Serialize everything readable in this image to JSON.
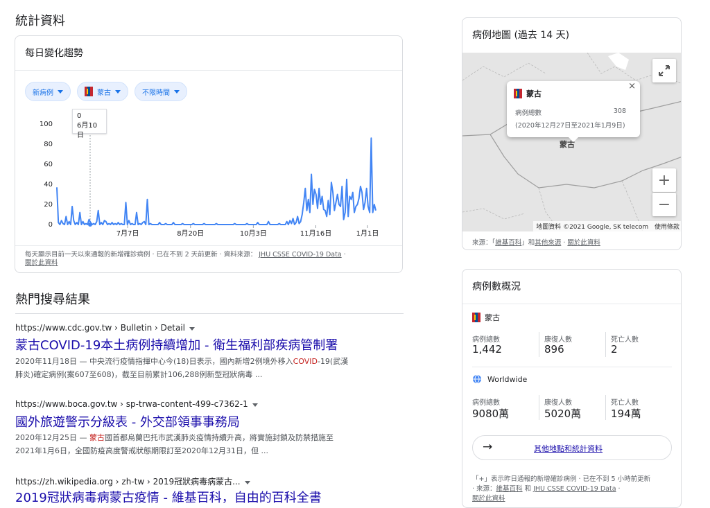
{
  "stats_heading": "統計資料",
  "trend_card": {
    "title": "每日變化趨勢",
    "chip_metric": "新病例",
    "chip_region": "蒙古",
    "chip_time": "不限時間",
    "tooltip_value": "0",
    "tooltip_date": "6月10日",
    "footer_text": "每天顯示目前一天以來通報的新增確診病例 · 已在不到 2 天前更新 · 資料來源：",
    "footer_source": "JHU CSSE COVID-19 Data",
    "footer_about": "關於此資料"
  },
  "chart_data": {
    "type": "line",
    "title": "",
    "xlabel": "",
    "ylabel": "",
    "ylim": [
      0,
      100
    ],
    "yticks": [
      "0",
      "20",
      "40",
      "60",
      "80",
      "100"
    ],
    "xtick_labels": [
      "7月7日",
      "8月20日",
      "10月3日",
      "11月16日",
      "1月1日"
    ],
    "series": [
      {
        "values": [
          37,
          2,
          0,
          4,
          1,
          0,
          8,
          0,
          3,
          0,
          18,
          4,
          0,
          2,
          0,
          12,
          0,
          3,
          0,
          1,
          0,
          5,
          2,
          0,
          1,
          0,
          3,
          14,
          0,
          2,
          0,
          4,
          3,
          0,
          1,
          0,
          2,
          0,
          1,
          0,
          2,
          0,
          1,
          0,
          0,
          22,
          0,
          4,
          0,
          1,
          0,
          0,
          12,
          0,
          1,
          0,
          2,
          3,
          0,
          25,
          0,
          1,
          0,
          0,
          0,
          0,
          0,
          2,
          0,
          0,
          0,
          1,
          0,
          0,
          0,
          0,
          2,
          0,
          0,
          0,
          0,
          0,
          1,
          0,
          0,
          0,
          0,
          0,
          0,
          1,
          0,
          0,
          0,
          0,
          0,
          0,
          1,
          0,
          0,
          0,
          0,
          0,
          0,
          0,
          1,
          0,
          0,
          0,
          0,
          0,
          0,
          0,
          0,
          0,
          0,
          0,
          1,
          0,
          0,
          0,
          0,
          0,
          0,
          0,
          1,
          0,
          0,
          0,
          0,
          0,
          0,
          2,
          0,
          0,
          0,
          0,
          0,
          0,
          3,
          0,
          0,
          0,
          0,
          0,
          0,
          1,
          0,
          0,
          0,
          0,
          3,
          0,
          4,
          1,
          6,
          0,
          2,
          8,
          1,
          3,
          10,
          22,
          36,
          14,
          25,
          12,
          50,
          20,
          35,
          30,
          16,
          36,
          20,
          28,
          15,
          14,
          8,
          24,
          10,
          42,
          32,
          14,
          22,
          30,
          20,
          18,
          38,
          5,
          12,
          45,
          8,
          28,
          25,
          32,
          12,
          18,
          20,
          26,
          38,
          32,
          15,
          22,
          36,
          18,
          12,
          86,
          12,
          20,
          14
        ]
      }
    ]
  },
  "top_results_heading": "熱門搜尋結果",
  "results": [
    {
      "url": "https://www.cdc.gov.tw › Bulletin › Detail",
      "title": "蒙古COVID-19本土病例持續增加 - 衛生福利部疾病管制署",
      "date": "2020年11月18日",
      "snippet_pre": " — 中央流行疫情指揮中心今(18)日表示，國內新增2例境外移入",
      "snippet_hl": "COVID",
      "snippet_post": "-19(武漢",
      "snippet_line2": "肺炎)確定病例(案607至608)，截至目前累計106,288例新型冠狀病毒 ..."
    },
    {
      "url": "https://www.boca.gov.tw › sp-trwa-content-499-c7362-1",
      "title": "國外旅遊警示分級表 - 外交部領事事務局",
      "date": "2020年12月25日",
      "snippet_pre": " — ",
      "snippet_hl": "蒙古",
      "snippet_post": "國首都烏蘭巴托市武漢肺炎疫情持續升高，將實施封鎖及防禁措施至",
      "snippet_line2": "2021年1月6日，全國防疫高度警戒狀態期限訂至2020年12月31日，但 ..."
    },
    {
      "url": "https://zh.wikipedia.org › zh-tw › 2019冠狀病毒病蒙古...",
      "title": "2019冠狀病毒病蒙古疫情 - 維基百科，自由的百科全書"
    }
  ],
  "map_card": {
    "title": "病例地圖 (過去 14 天)",
    "popup_region": "蒙古",
    "popup_label": "病例總數",
    "popup_value": "308",
    "popup_range": "(2020年12月27日至2021年1月9日)",
    "popup_close": "×",
    "map_label": "蒙古",
    "attribution": "地圖資料 ©2021 Google, SK telecom",
    "terms": "使用條款",
    "zoom_in": "+",
    "zoom_out": "−",
    "source_prefix": "來源：「",
    "source_wiki": "維基百科",
    "source_mid": "」和",
    "source_other": "其他來源",
    "source_sep": " · ",
    "source_about": "關於此資料"
  },
  "overview_card": {
    "title": "病例數概況",
    "region_name": "蒙古",
    "region": {
      "cases_label": "病例總數",
      "cases_value": "1,442",
      "recovered_label": "康復人數",
      "recovered_value": "896",
      "deaths_label": "死亡人數",
      "deaths_value": "2"
    },
    "world_name": "Worldwide",
    "world": {
      "cases_label": "病例總數",
      "cases_value": "9080萬",
      "recovered_label": "康復人數",
      "recovered_value": "5020萬",
      "deaths_label": "死亡人數",
      "deaths_value": "194萬"
    },
    "more_button": "其他地點和統計資料",
    "footnote_line1": "「+」表示昨日通報的新增確診病例 · 已在不到 5 小時前更新",
    "footnote_prefix": "· 來源：",
    "footnote_wiki": "維基百科",
    "footnote_and": " 和 ",
    "footnote_jhu": "JHU CSSE COVID-19 Data",
    "footnote_tail": " · ",
    "footnote_about": "關於此資料"
  },
  "colors": {
    "accent": "#1a73e8",
    "line": "#4285f4",
    "link": "#1a0dab",
    "highlight": "#c5221f"
  }
}
